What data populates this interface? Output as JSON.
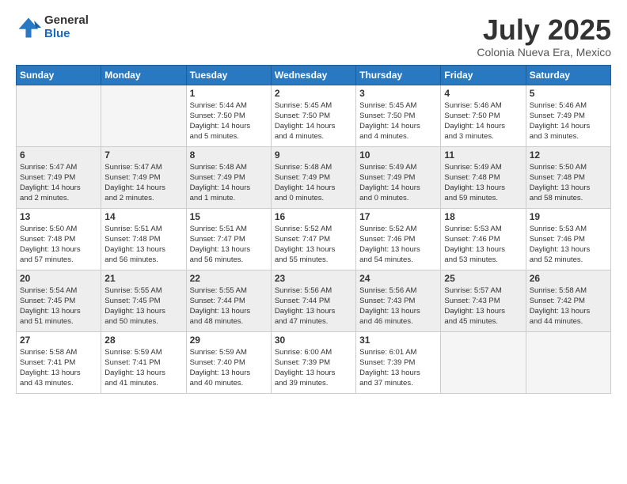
{
  "logo": {
    "general": "General",
    "blue": "Blue"
  },
  "header": {
    "title": "July 2025",
    "subtitle": "Colonia Nueva Era, Mexico"
  },
  "days_of_week": [
    "Sunday",
    "Monday",
    "Tuesday",
    "Wednesday",
    "Thursday",
    "Friday",
    "Saturday"
  ],
  "weeks": [
    [
      {
        "day": "",
        "info": ""
      },
      {
        "day": "",
        "info": ""
      },
      {
        "day": "1",
        "info": "Sunrise: 5:44 AM\nSunset: 7:50 PM\nDaylight: 14 hours\nand 5 minutes."
      },
      {
        "day": "2",
        "info": "Sunrise: 5:45 AM\nSunset: 7:50 PM\nDaylight: 14 hours\nand 4 minutes."
      },
      {
        "day": "3",
        "info": "Sunrise: 5:45 AM\nSunset: 7:50 PM\nDaylight: 14 hours\nand 4 minutes."
      },
      {
        "day": "4",
        "info": "Sunrise: 5:46 AM\nSunset: 7:50 PM\nDaylight: 14 hours\nand 3 minutes."
      },
      {
        "day": "5",
        "info": "Sunrise: 5:46 AM\nSunset: 7:49 PM\nDaylight: 14 hours\nand 3 minutes."
      }
    ],
    [
      {
        "day": "6",
        "info": "Sunrise: 5:47 AM\nSunset: 7:49 PM\nDaylight: 14 hours\nand 2 minutes."
      },
      {
        "day": "7",
        "info": "Sunrise: 5:47 AM\nSunset: 7:49 PM\nDaylight: 14 hours\nand 2 minutes."
      },
      {
        "day": "8",
        "info": "Sunrise: 5:48 AM\nSunset: 7:49 PM\nDaylight: 14 hours\nand 1 minute."
      },
      {
        "day": "9",
        "info": "Sunrise: 5:48 AM\nSunset: 7:49 PM\nDaylight: 14 hours\nand 0 minutes."
      },
      {
        "day": "10",
        "info": "Sunrise: 5:49 AM\nSunset: 7:49 PM\nDaylight: 14 hours\nand 0 minutes."
      },
      {
        "day": "11",
        "info": "Sunrise: 5:49 AM\nSunset: 7:48 PM\nDaylight: 13 hours\nand 59 minutes."
      },
      {
        "day": "12",
        "info": "Sunrise: 5:50 AM\nSunset: 7:48 PM\nDaylight: 13 hours\nand 58 minutes."
      }
    ],
    [
      {
        "day": "13",
        "info": "Sunrise: 5:50 AM\nSunset: 7:48 PM\nDaylight: 13 hours\nand 57 minutes."
      },
      {
        "day": "14",
        "info": "Sunrise: 5:51 AM\nSunset: 7:48 PM\nDaylight: 13 hours\nand 56 minutes."
      },
      {
        "day": "15",
        "info": "Sunrise: 5:51 AM\nSunset: 7:47 PM\nDaylight: 13 hours\nand 56 minutes."
      },
      {
        "day": "16",
        "info": "Sunrise: 5:52 AM\nSunset: 7:47 PM\nDaylight: 13 hours\nand 55 minutes."
      },
      {
        "day": "17",
        "info": "Sunrise: 5:52 AM\nSunset: 7:46 PM\nDaylight: 13 hours\nand 54 minutes."
      },
      {
        "day": "18",
        "info": "Sunrise: 5:53 AM\nSunset: 7:46 PM\nDaylight: 13 hours\nand 53 minutes."
      },
      {
        "day": "19",
        "info": "Sunrise: 5:53 AM\nSunset: 7:46 PM\nDaylight: 13 hours\nand 52 minutes."
      }
    ],
    [
      {
        "day": "20",
        "info": "Sunrise: 5:54 AM\nSunset: 7:45 PM\nDaylight: 13 hours\nand 51 minutes."
      },
      {
        "day": "21",
        "info": "Sunrise: 5:55 AM\nSunset: 7:45 PM\nDaylight: 13 hours\nand 50 minutes."
      },
      {
        "day": "22",
        "info": "Sunrise: 5:55 AM\nSunset: 7:44 PM\nDaylight: 13 hours\nand 48 minutes."
      },
      {
        "day": "23",
        "info": "Sunrise: 5:56 AM\nSunset: 7:44 PM\nDaylight: 13 hours\nand 47 minutes."
      },
      {
        "day": "24",
        "info": "Sunrise: 5:56 AM\nSunset: 7:43 PM\nDaylight: 13 hours\nand 46 minutes."
      },
      {
        "day": "25",
        "info": "Sunrise: 5:57 AM\nSunset: 7:43 PM\nDaylight: 13 hours\nand 45 minutes."
      },
      {
        "day": "26",
        "info": "Sunrise: 5:58 AM\nSunset: 7:42 PM\nDaylight: 13 hours\nand 44 minutes."
      }
    ],
    [
      {
        "day": "27",
        "info": "Sunrise: 5:58 AM\nSunset: 7:41 PM\nDaylight: 13 hours\nand 43 minutes."
      },
      {
        "day": "28",
        "info": "Sunrise: 5:59 AM\nSunset: 7:41 PM\nDaylight: 13 hours\nand 41 minutes."
      },
      {
        "day": "29",
        "info": "Sunrise: 5:59 AM\nSunset: 7:40 PM\nDaylight: 13 hours\nand 40 minutes."
      },
      {
        "day": "30",
        "info": "Sunrise: 6:00 AM\nSunset: 7:39 PM\nDaylight: 13 hours\nand 39 minutes."
      },
      {
        "day": "31",
        "info": "Sunrise: 6:01 AM\nSunset: 7:39 PM\nDaylight: 13 hours\nand 37 minutes."
      },
      {
        "day": "",
        "info": ""
      },
      {
        "day": "",
        "info": ""
      }
    ]
  ]
}
